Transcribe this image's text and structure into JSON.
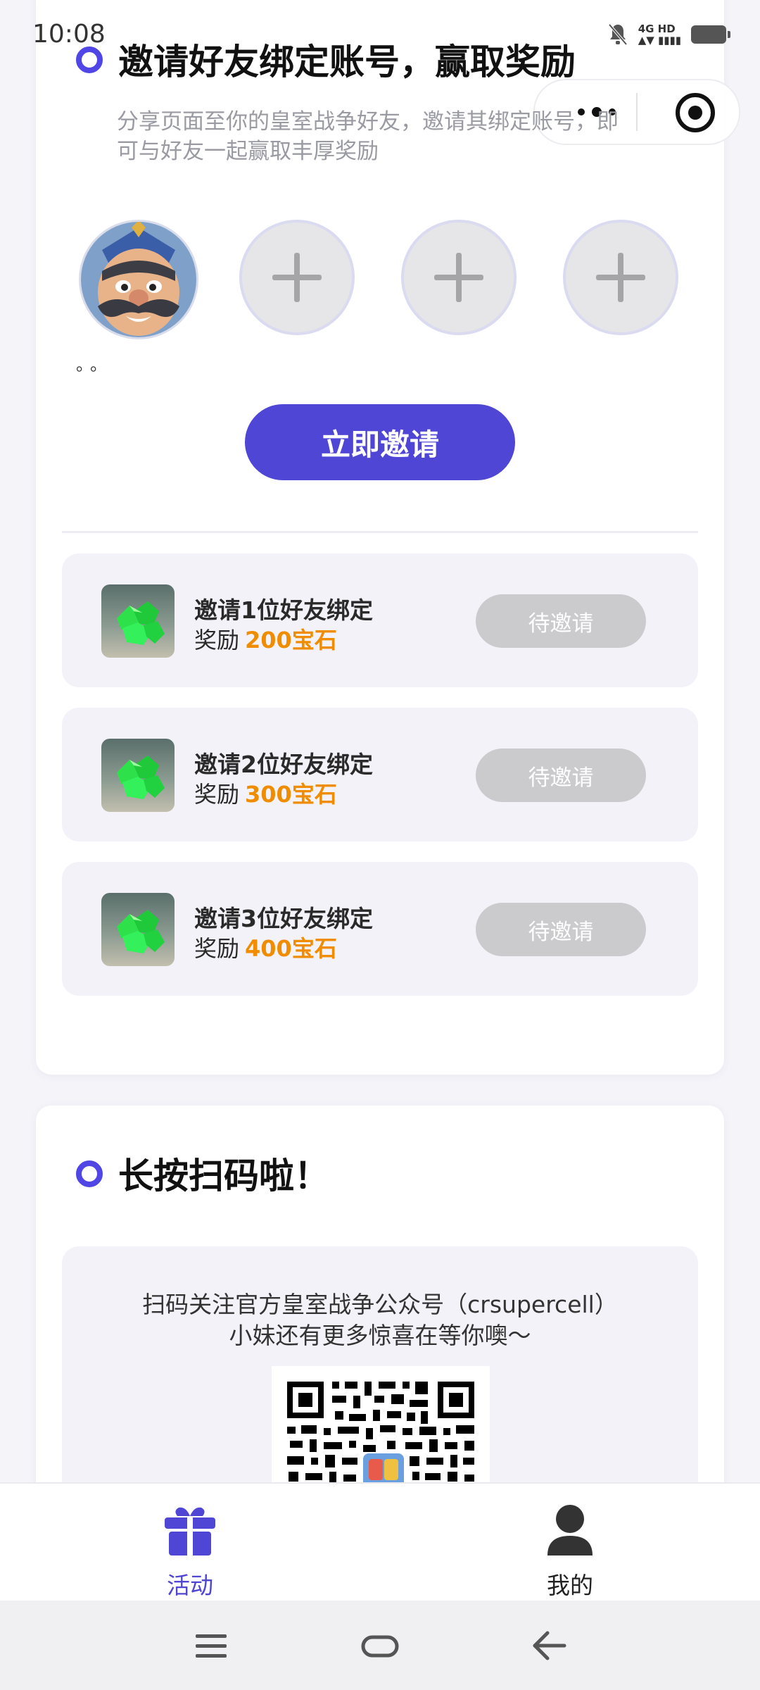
{
  "status_bar": {
    "time": "10:08",
    "network_top": "4G HD",
    "network_bottom": "▲▼ ▮▮▮▮"
  },
  "invite_section": {
    "title": "邀请好友绑定账号，赢取奖励",
    "subtitle": "分享页面至你的皇室战争好友，邀请其绑定账号，即可与好友一起赢取丰厚奖励",
    "avatar_name": "。。",
    "invite_button": "立即邀请",
    "rewards": [
      {
        "title": "邀请1位好友绑定",
        "prefix": "奖励",
        "amount": "200宝石",
        "button": "待邀请"
      },
      {
        "title": "邀请2位好友绑定",
        "prefix": "奖励",
        "amount": "300宝石",
        "button": "待邀请"
      },
      {
        "title": "邀请3位好友绑定",
        "prefix": "奖励",
        "amount": "400宝石",
        "button": "待邀请"
      }
    ]
  },
  "qr_section": {
    "title": "长按扫码啦！",
    "line1": "扫码关注官方皇室战争公众号（crsupercell）",
    "line2": "小妹还有更多惊喜在等你噢～"
  },
  "tabbar": {
    "tabs": [
      {
        "label": "活动",
        "icon": "gift-icon",
        "active": true
      },
      {
        "label": "我的",
        "icon": "user-icon",
        "active": false
      }
    ]
  },
  "colors": {
    "accent": "#4f46d6",
    "reward_amount": "#f08c00",
    "pending_button": "#cbcbcd"
  }
}
